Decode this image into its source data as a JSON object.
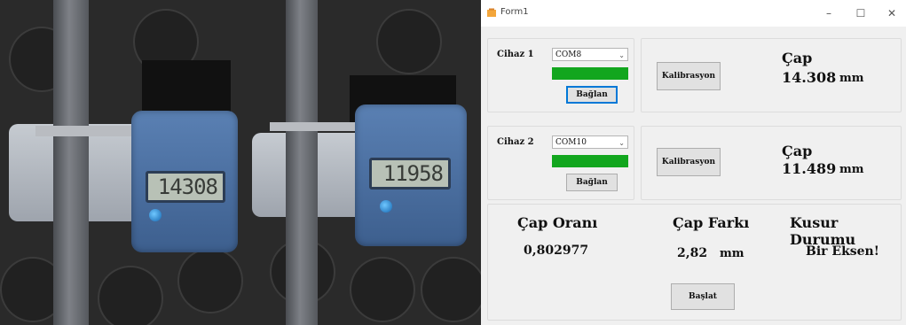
{
  "photo": {
    "readings": [
      "14308",
      "11958"
    ]
  },
  "window": {
    "title": "Form1",
    "controls": {
      "minimize": "–",
      "maximize": "☐",
      "close": "✕"
    }
  },
  "device1": {
    "label": "Cihaz 1",
    "port": "COM8",
    "connect_button": "Bağlan",
    "status_color": "#12a61e",
    "calibrate_button": "Kalibrasyon",
    "diameter_label": "Çap",
    "diameter_value": "14.308",
    "unit": "mm"
  },
  "device2": {
    "label": "Cihaz 2",
    "port": "COM10",
    "connect_button": "Bağlan",
    "status_color": "#12a61e",
    "calibrate_button": "Kalibrasyon",
    "diameter_label": "Çap",
    "diameter_value": "11.489",
    "unit": "mm"
  },
  "results": {
    "ratio_label": "Çap Oranı",
    "ratio_value": "0,802977",
    "diff_label": "Çap Farkı",
    "diff_value": "2,82",
    "diff_unit": "mm",
    "defect_label": "Kusur Durumu",
    "defect_value": "Bir Eksen!",
    "start_button": "Başlat"
  }
}
